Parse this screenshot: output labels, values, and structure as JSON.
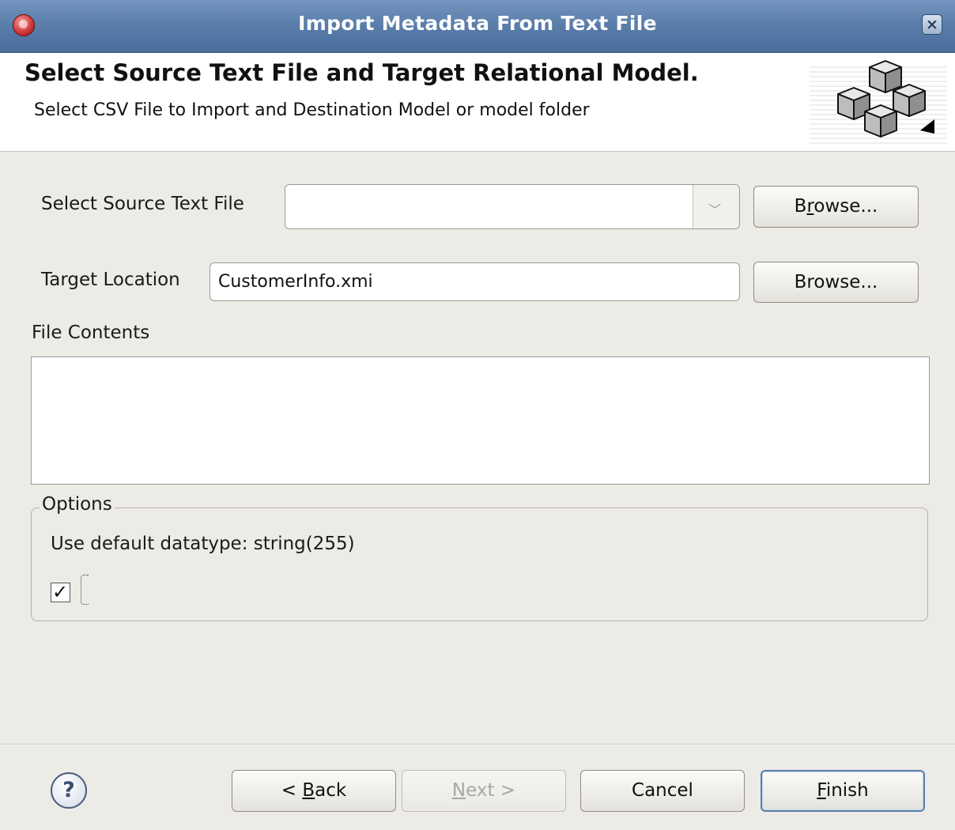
{
  "window": {
    "title": "Import Metadata From Text File",
    "app_icon": "redhat-shadowman-icon",
    "close_icon": "close-icon"
  },
  "banner": {
    "heading": "Select Source Text File and Target Relational Model.",
    "subheading": "Select CSV File to Import and Destination Model or model folder",
    "graphic": "stacked-cubes-icon"
  },
  "source": {
    "label": "Select Source Text File",
    "value": "",
    "browse_label_before": "B",
    "browse_label_mnemonic": "r",
    "browse_label_after": "owse..."
  },
  "target": {
    "label": "Target Location",
    "value": "CustomerInfo.xmi",
    "browse_label": "Browse..."
  },
  "file_contents": {
    "label": "File Contents"
  },
  "options": {
    "title": "Options",
    "default_datatype_label": "Use default datatype: string(255)",
    "checkbox_checked": true
  },
  "footer": {
    "help_icon": "help-icon",
    "back_prefix": "< ",
    "back_mnemonic": "B",
    "back_rest": "ack",
    "next_mnemonic": "N",
    "next_rest": "ext >",
    "cancel_label": "Cancel",
    "finish_mnemonic": "F",
    "finish_rest": "inish"
  },
  "colors": {
    "titlebar": "#5b7eab",
    "dialog_bg": "#ecebe6",
    "default_button_border": "#5a7fb0"
  }
}
